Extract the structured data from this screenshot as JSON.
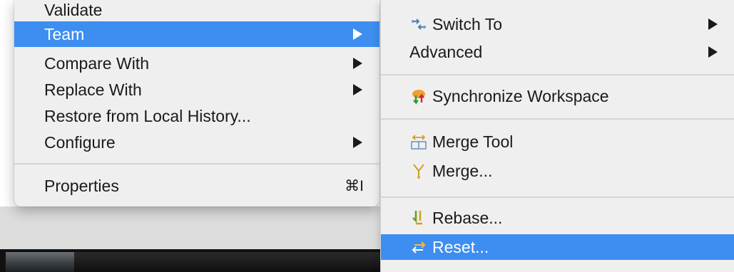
{
  "left_menu": {
    "items": [
      {
        "label": "Validate",
        "has_submenu": false
      },
      {
        "label": "Team",
        "has_submenu": true,
        "highlighted": true
      },
      {
        "label": "Compare With",
        "has_submenu": true
      },
      {
        "label": "Replace With",
        "has_submenu": true
      },
      {
        "label": "Restore from Local History...",
        "has_submenu": false
      },
      {
        "label": "Configure",
        "has_submenu": true
      },
      {
        "label": "Properties",
        "shortcut": "⌘I"
      }
    ]
  },
  "team_submenu": {
    "items": [
      {
        "label": "Switch To",
        "icon": "switch-to-icon",
        "has_submenu": true
      },
      {
        "label": "Advanced",
        "has_submenu": true
      },
      {
        "label": "Synchronize Workspace",
        "icon": "synchronize-icon"
      },
      {
        "label": "Merge Tool",
        "icon": "merge-tool-icon"
      },
      {
        "label": "Merge...",
        "icon": "merge-icon"
      },
      {
        "label": "Rebase...",
        "icon": "rebase-icon"
      },
      {
        "label": "Reset...",
        "icon": "reset-icon",
        "highlighted": true
      }
    ]
  },
  "colors": {
    "highlight": "#3d8ef0",
    "menu_background": "#efefef"
  }
}
